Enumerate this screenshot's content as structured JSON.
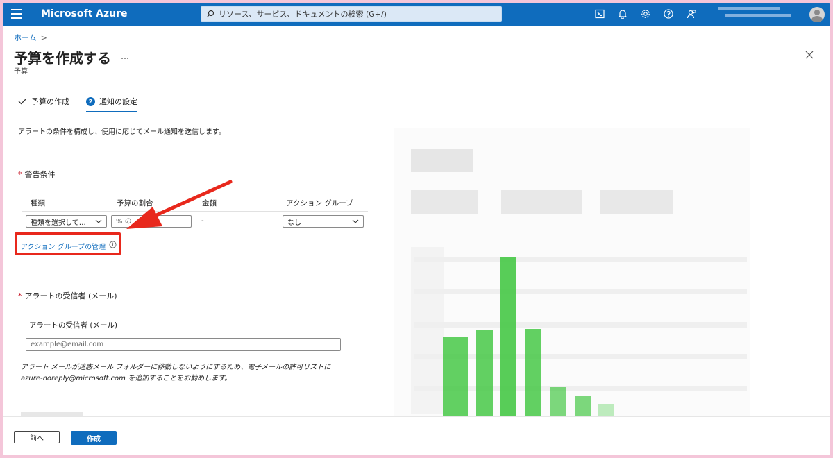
{
  "topbar": {
    "brand": "Microsoft Azure",
    "search_placeholder": "リソース、サービス、ドキュメントの検索 (G+/)",
    "icons": [
      "cloud-shell-icon",
      "bell-icon",
      "gear-icon",
      "help-icon",
      "feedback-icon"
    ]
  },
  "header": {
    "breadcrumb": "ホーム",
    "breadcrumb_sep": ">",
    "title": "予算を作成する",
    "more": "…",
    "subtitle": "予算"
  },
  "tabs": [
    {
      "label": "予算の作成",
      "state": "done"
    },
    {
      "label": "通知の設定",
      "step": "2",
      "state": "active"
    }
  ],
  "description": "アラートの条件を構成し、使用に応じてメール通知を送信します。",
  "alert_conditions": {
    "required_mark": "*",
    "title": "警告条件",
    "columns": [
      "種類",
      "予算の割合",
      "金額",
      "アクション グループ"
    ],
    "type_select": "種類を選択して…",
    "percent_placeholder": "% の",
    "amount": "-",
    "action_group_select": "なし",
    "manage_link": "アクション グループの管理"
  },
  "recipients": {
    "required_mark": "*",
    "title": "アラートの受信者 (メール)",
    "column": "アラートの受信者 (メール)",
    "email_placeholder": "example@email.com",
    "note": "アラート メールが迷惑メール フォルダーに移動しないようにするため、電子メールの許可リストに azure-noreply@microsoft.com を追加することをお勧めします。"
  },
  "footer": {
    "prev": "前へ",
    "create": "作成"
  },
  "colors": {
    "brand_blue": "#0f6cbd",
    "highlight_red": "#e8281c",
    "bar_green": "#46c846",
    "frame_pink": "#f4c6d9"
  }
}
